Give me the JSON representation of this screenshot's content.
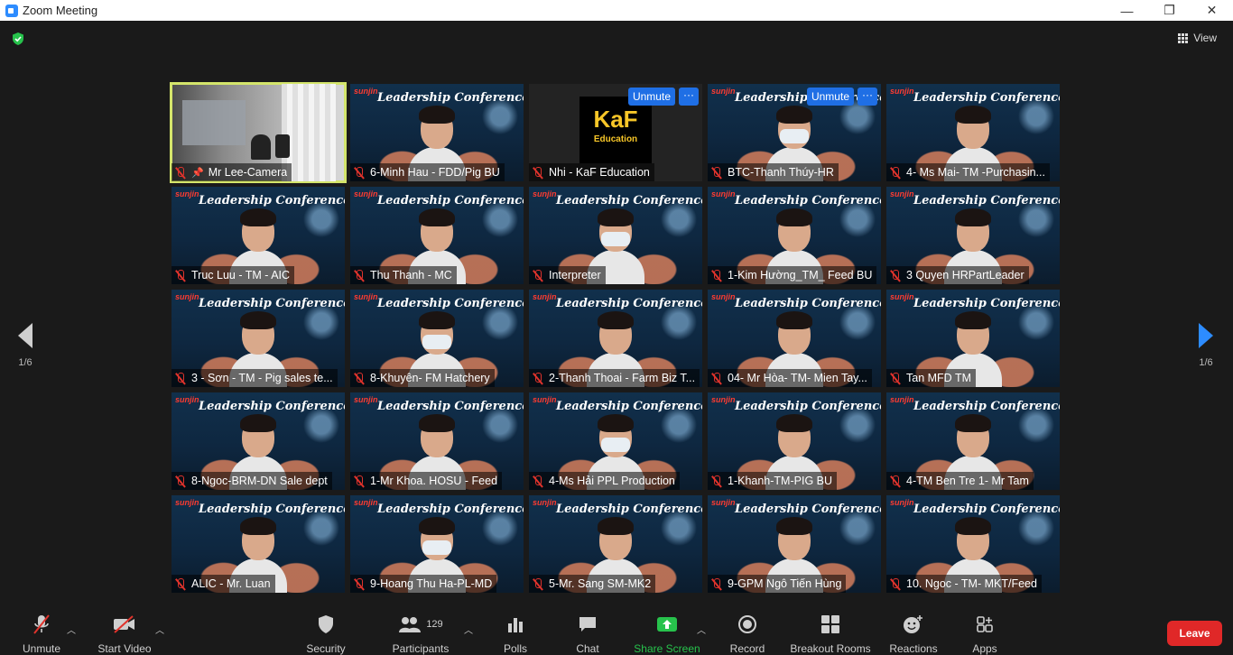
{
  "window": {
    "title": "Zoom Meeting",
    "controls": {
      "minimize": "—",
      "maximize": "❐",
      "close": "✕"
    }
  },
  "view": {
    "label": "View"
  },
  "paging": {
    "left_label": "1/6",
    "right_label": "1/6"
  },
  "tile_bg": {
    "logo": "sunjin",
    "title": "Leadership Conference"
  },
  "kaf_logo": {
    "big": "KaF",
    "small": "Education"
  },
  "unmute_label": "Unmute",
  "more_label": "···",
  "participants_tiles": [
    {
      "name": "Mr Lee-Camera"
    },
    {
      "name": "6-Minh Hau - FDD/Pig BU"
    },
    {
      "name": "Nhi - KaF Education"
    },
    {
      "name": "BTC-Thanh Thúy-HR"
    },
    {
      "name": "4- Ms Mai- TM -Purchasin..."
    },
    {
      "name": "Truc Luu - TM - AIC"
    },
    {
      "name": "Thu Thanh - MC"
    },
    {
      "name": "Interpreter"
    },
    {
      "name": "1-Kim Hường_TM_ Feed BU"
    },
    {
      "name": "3 Quyen HRPartLeader"
    },
    {
      "name": "3 - Sơn - TM - Pig sales te..."
    },
    {
      "name": "8-Khuyên- FM Hatchery"
    },
    {
      "name": "2-Thanh Thoai - Farm Biz T..."
    },
    {
      "name": "04- Mr Hòa- TM- Mien Tay..."
    },
    {
      "name": "Tan MFD TM"
    },
    {
      "name": "8-Ngoc-BRM-DN Sale dept"
    },
    {
      "name": "1-Mr Khoa. HOSU - Feed"
    },
    {
      "name": "4-Ms Hải PPL Production"
    },
    {
      "name": "1-Khanh-TM-PIG BU"
    },
    {
      "name": "4-TM Ben Tre 1- Mr Tam"
    },
    {
      "name": "ALIC - Mr. Luan"
    },
    {
      "name": "9-Hoang Thu Ha-PL-MD"
    },
    {
      "name": "5-Mr. Sang SM-MK2"
    },
    {
      "name": "9-GPM Ngô Tiến Hùng"
    },
    {
      "name": "10. Ngoc - TM- MKT/Feed"
    }
  ],
  "toolbar": {
    "unmute": "Unmute",
    "start_video": "Start Video",
    "security": "Security",
    "participants": "Participants",
    "participants_count": "129",
    "polls": "Polls",
    "chat": "Chat",
    "share_screen": "Share Screen",
    "record": "Record",
    "breakout_rooms": "Breakout Rooms",
    "reactions": "Reactions",
    "apps": "Apps",
    "leave": "Leave"
  },
  "colors": {
    "accent": "#2d8cff",
    "active_speaker": "#d4e56b",
    "leave": "#e02828",
    "share": "#27c24c",
    "muted": "#e0332c"
  }
}
